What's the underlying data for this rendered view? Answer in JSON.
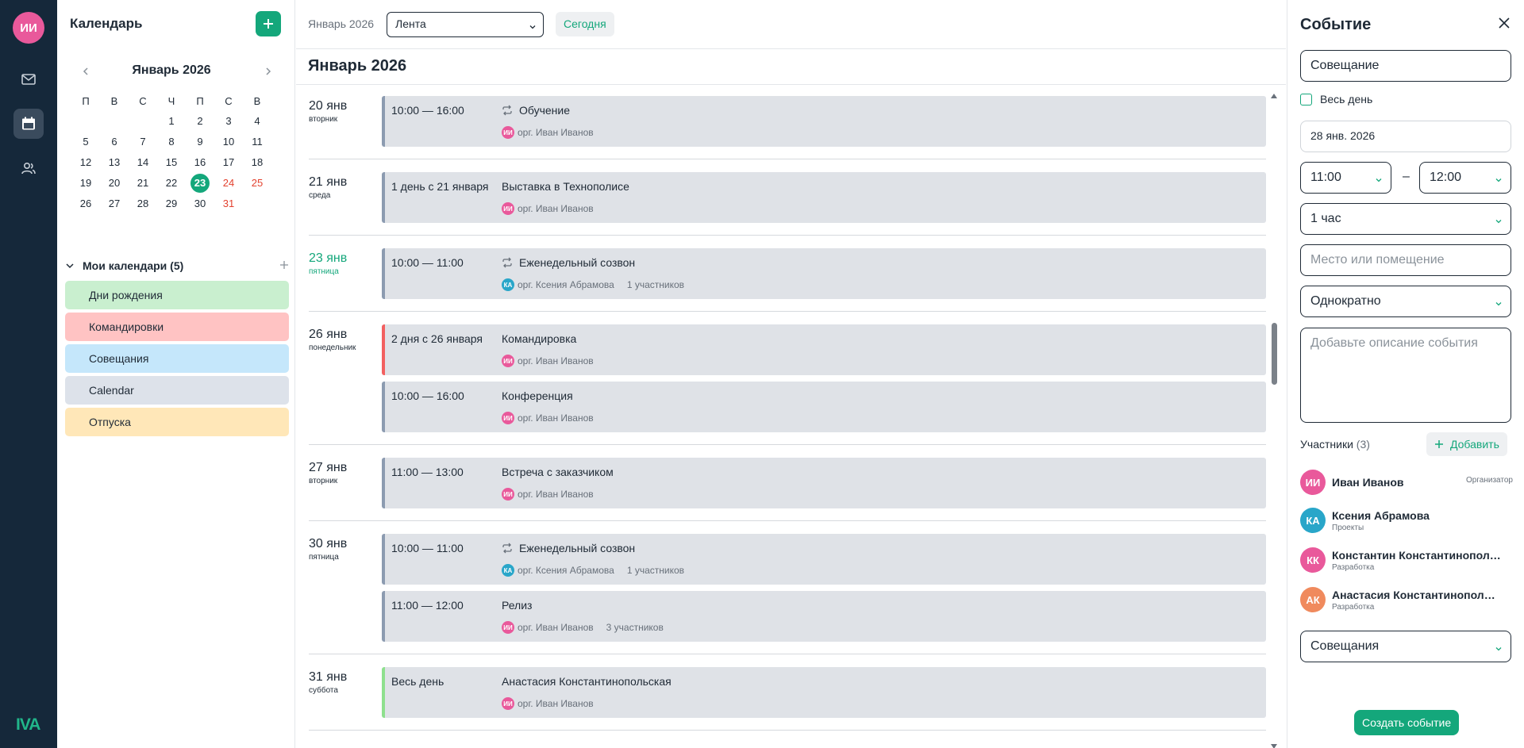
{
  "user": {
    "initials": "ИИ"
  },
  "brand": "IVA",
  "sidebar": {
    "title": "Календарь",
    "mini_calendar": {
      "month": "Январь 2026",
      "weekdays": [
        "П",
        "В",
        "С",
        "Ч",
        "П",
        "С",
        "В"
      ],
      "weeks": [
        [
          "",
          "",
          "",
          "1",
          "2",
          "3",
          "4"
        ],
        [
          "5",
          "6",
          "7",
          "8",
          "9",
          "10",
          "11"
        ],
        [
          "12",
          "13",
          "14",
          "15",
          "16",
          "17",
          "18"
        ],
        [
          "19",
          "20",
          "21",
          "22",
          "23",
          "24",
          "25"
        ],
        [
          "26",
          "27",
          "28",
          "29",
          "30",
          "31",
          ""
        ]
      ],
      "today": "23",
      "red_days": [
        "24",
        "25",
        "31"
      ]
    },
    "my_calendars": {
      "label": "Мои календари (5)",
      "items": [
        {
          "name": "Дни рождения",
          "color": "#c9efcf"
        },
        {
          "name": "Командировки",
          "color": "#ffc3c3"
        },
        {
          "name": "Совещания",
          "color": "#c5e7fb"
        },
        {
          "name": "Calendar",
          "color": "#dde2ea"
        },
        {
          "name": "Отпуска",
          "color": "#ffe7b8"
        }
      ]
    }
  },
  "toolbar": {
    "month": "Январь 2026",
    "view": "Лента",
    "today": "Сегодня"
  },
  "main": {
    "title": "Январь 2026",
    "days": [
      {
        "num": "20 янв",
        "weekday": "вторник",
        "today": false,
        "events": [
          {
            "time": "10:00 — 16:00",
            "title": "Обучение",
            "recurring": true,
            "org": "орг. Иван Иванов",
            "org_initials": "ИИ",
            "org_color": "#e9599b",
            "count": "",
            "accent": "#8c9bb0"
          }
        ]
      },
      {
        "num": "21 янв",
        "weekday": "среда",
        "today": false,
        "events": [
          {
            "time": "1 день с 21 января",
            "title": "Выставка в Технополисе",
            "recurring": false,
            "org": "орг. Иван Иванов",
            "org_initials": "ИИ",
            "org_color": "#e9599b",
            "count": "",
            "accent": "#8c9bb0"
          }
        ]
      },
      {
        "num": "23 янв",
        "weekday": "пятница",
        "today": true,
        "events": [
          {
            "time": "10:00 — 11:00",
            "title": "Еженедельный созвон",
            "recurring": true,
            "org": "орг. Ксения Абрамова",
            "org_initials": "КА",
            "org_color": "#29a6c9",
            "count": "1 участников",
            "accent": "#8c9bb0"
          }
        ]
      },
      {
        "num": "26 янв",
        "weekday": "понедельник",
        "today": false,
        "events": [
          {
            "time": "2 дня с 26 января",
            "title": "Командировка",
            "recurring": false,
            "org": "орг. Иван Иванов",
            "org_initials": "ИИ",
            "org_color": "#e9599b",
            "count": "",
            "accent": "#f26060"
          },
          {
            "time": "10:00 — 16:00",
            "title": "Конференция",
            "recurring": false,
            "org": "орг. Иван Иванов",
            "org_initials": "ИИ",
            "org_color": "#e9599b",
            "count": "",
            "accent": "#8c9bb0"
          }
        ]
      },
      {
        "num": "27 янв",
        "weekday": "вторник",
        "today": false,
        "events": [
          {
            "time": "11:00 — 13:00",
            "title": "Встреча с заказчиком",
            "recurring": false,
            "org": "орг. Иван Иванов",
            "org_initials": "ИИ",
            "org_color": "#e9599b",
            "count": "",
            "accent": "#8c9bb0"
          }
        ]
      },
      {
        "num": "30 янв",
        "weekday": "пятница",
        "today": false,
        "events": [
          {
            "time": "10:00 — 11:00",
            "title": "Еженедельный созвон",
            "recurring": true,
            "org": "орг. Ксения Абрамова",
            "org_initials": "КА",
            "org_color": "#29a6c9",
            "count": "1 участников",
            "accent": "#8c9bb0"
          },
          {
            "time": "11:00 — 12:00",
            "title": "Релиз",
            "recurring": false,
            "org": "орг. Иван Иванов",
            "org_initials": "ИИ",
            "org_color": "#e9599b",
            "count": "3 участников",
            "accent": "#8c9bb0"
          }
        ]
      },
      {
        "num": "31 янв",
        "weekday": "суббота",
        "today": false,
        "events": [
          {
            "time": "Весь день",
            "title": "Анастасия Константинопольская",
            "recurring": false,
            "org": "орг. Иван Иванов",
            "org_initials": "ИИ",
            "org_color": "#e9599b",
            "count": "",
            "accent": "#8ee08e"
          }
        ]
      }
    ]
  },
  "panel": {
    "title": "Событие",
    "name_value": "Совещание",
    "all_day": "Весь день",
    "date": "28 янв. 2026",
    "time_start": "11:00",
    "time_sep": "–",
    "time_end": "12:00",
    "duration": "1 час",
    "place_placeholder": "Место или помещение",
    "repeat": "Однократно",
    "description_placeholder": "Добавьте описание события",
    "participants_label": "Участники",
    "participants_count": "(3)",
    "add_label": "Добавить",
    "participants": [
      {
        "initials": "ИИ",
        "name": "Иван Иванов",
        "sub": "",
        "role": "Организатор",
        "color": "#e9599b"
      },
      {
        "initials": "КА",
        "name": "Ксения Абрамова",
        "sub": "Проекты",
        "role": "",
        "color": "#29a6c9"
      },
      {
        "initials": "КК",
        "name": "Константин Константинопольский",
        "sub": "Разработка",
        "role": "",
        "color": "#e9599b"
      },
      {
        "initials": "АК",
        "name": "Анастасия Константинопольская",
        "sub": "Разработка",
        "role": "",
        "color": "#f08a5d"
      }
    ],
    "calendar_select": "Совещания",
    "create_label": "Создать событие"
  },
  "colors": {
    "accent": "#14a77b",
    "rail": "#15283a",
    "weekend": "#e3422f"
  }
}
